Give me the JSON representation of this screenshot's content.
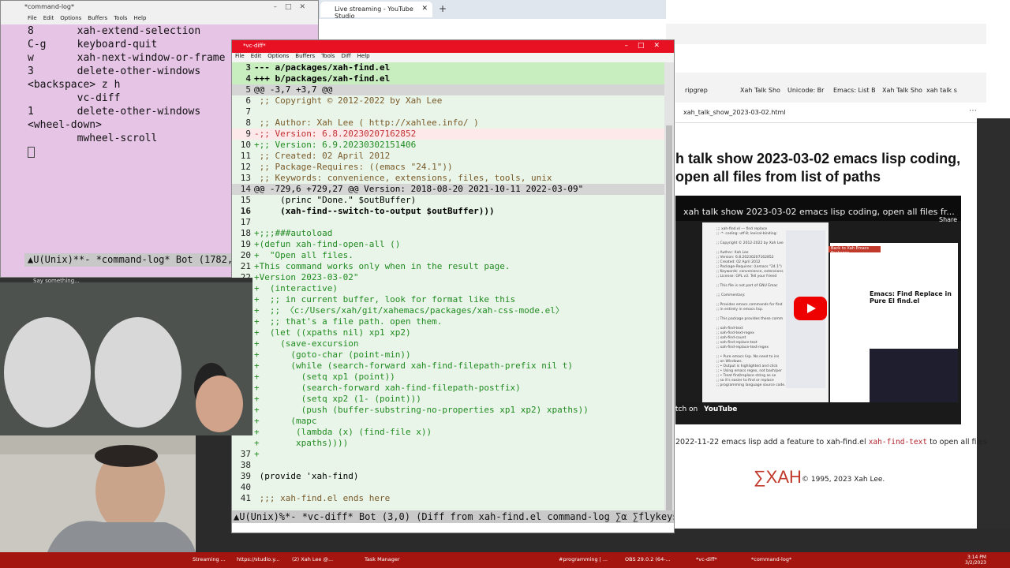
{
  "cmdlog": {
    "title": "*command-log*",
    "menu": [
      "File",
      "Edit",
      "Options",
      "Buffers",
      "Tools",
      "Help"
    ],
    "lines": [
      "8       xah-extend-selection",
      "C-g     keyboard-quit",
      "w       xah-next-window-or-frame",
      "3       delete-other-windows",
      "<backspace> z h",
      "        vc-diff",
      "1       delete-other-windows",
      "<wheel-down>",
      "        mwheel-scroll"
    ],
    "modeline": "U(Unix)**- *command-log* Bot (1782,0)"
  },
  "ytstudio": {
    "tab_label": "Live streaming - YouTube Studio"
  },
  "browser": {
    "tabs": [
      "ripgrep",
      "Xah Talk Sho",
      "Unicode: Br",
      "Emacs: List B",
      "Xah Talk Sho",
      "xah talk s"
    ],
    "url": "xah_talk_show_2023-03-02.html",
    "heading": "h talk show 2023-03-02 emacs lisp coding, open all files from list of paths",
    "video_title": "xah talk show 2023-03-02 emacs lisp coding, open all files fr...",
    "video_share": "Share",
    "video_watch": "tch on",
    "video_logo": "YouTube",
    "video_red_button": "Back to Xah Emacs Packages",
    "video_page_title": "Emacs: Find Replace in Pure El find.el",
    "note_prefix": "2022-11-22 emacs lisp add a feature to xah-find.el ",
    "note_code": "xah-find-text",
    "note_suffix": " to open all files",
    "logo": "∑XAH",
    "copyright": "© 1995, 2023 Xah Lee."
  },
  "vcdiff": {
    "title": "*vc-diff*",
    "menu": [
      "File",
      "Edit",
      "Options",
      "Buffers",
      "Tools",
      "Diff",
      "Help"
    ],
    "lines": [
      {
        "n": "3",
        "t": "--- a/packages/xah-find.el",
        "cls": "hl-green b"
      },
      {
        "n": "4",
        "t": "+++ b/packages/xah-find.el",
        "cls": "hl-green b"
      },
      {
        "n": "5",
        "t": "@@ -3,7 +3,7 @@",
        "cls": "hunk"
      },
      {
        "n": "6",
        "t": " ;; Copyright © 2012-2022 by Xah Lee",
        "cls": "c-gray"
      },
      {
        "n": "7",
        "t": "",
        "cls": ""
      },
      {
        "n": "8",
        "t": " ;; Author: Xah Lee ( http://xahlee.info/ )",
        "cls": "c-gray"
      },
      {
        "n": "9",
        "t": "-;; Version: 6.8.20230207162852",
        "cls": "hl-red c-red"
      },
      {
        "n": "10",
        "t": "+;; Version: 6.9.20230302151406",
        "cls": "c-green"
      },
      {
        "n": "11",
        "t": " ;; Created: 02 April 2012",
        "cls": "c-gray"
      },
      {
        "n": "12",
        "t": " ;; Package-Requires: ((emacs \"24.1\"))",
        "cls": "c-gray"
      },
      {
        "n": "13",
        "t": " ;; Keywords: convenience, extensions, files, tools, unix",
        "cls": "c-gray"
      },
      {
        "n": "14",
        "t": "@@ -729,6 +729,27 @@ Version: 2018-08-20 2021-10-11 2022-03-09\"",
        "cls": "hunk"
      },
      {
        "n": "15",
        "t": "     (princ \"Done.\" $outBuffer)",
        "cls": ""
      },
      {
        "n": "16",
        "t": "     (xah-find--switch-to-output $outBuffer)))",
        "cls": "b"
      },
      {
        "n": "17",
        "t": "",
        "cls": ""
      },
      {
        "n": "18",
        "t": "+;;;###autoload",
        "cls": "c-green"
      },
      {
        "n": "19",
        "t": "+(defun xah-find-open-all ()",
        "cls": "c-green"
      },
      {
        "n": "20",
        "t": "+  \"Open all files.",
        "cls": "c-green"
      },
      {
        "n": "21",
        "t": "+This command works only when in the result page.",
        "cls": "c-green"
      },
      {
        "n": "22",
        "t": "+Version 2023-03-02\"",
        "cls": "c-green"
      },
      {
        "n": "",
        "t": "+  (interactive)",
        "cls": "c-green"
      },
      {
        "n": "",
        "t": "+  ;; in current buffer, look for format like this",
        "cls": "c-green"
      },
      {
        "n": "",
        "t": "+  ;; 〈c:/Users/xah/git/xahemacs/packages/xah-css-mode.el〉",
        "cls": "c-green"
      },
      {
        "n": "",
        "t": "+  ;; that's a file path. open them.",
        "cls": "c-green"
      },
      {
        "n": "",
        "t": "+  (let ((xpaths nil) xp1 xp2)",
        "cls": "c-green"
      },
      {
        "n": "",
        "t": "+    (save-excursion",
        "cls": "c-green"
      },
      {
        "n": "",
        "t": "+      (goto-char (point-min))",
        "cls": "c-green"
      },
      {
        "n": "",
        "t": "+      (while (search-forward xah-find-filepath-prefix nil t)",
        "cls": "c-green"
      },
      {
        "n": "",
        "t": "+        (setq xp1 (point))",
        "cls": "c-green"
      },
      {
        "n": "",
        "t": "+        (search-forward xah-find-filepath-postfix)",
        "cls": "c-green"
      },
      {
        "n": "",
        "t": "+        (setq xp2 (1- (point)))",
        "cls": "c-green"
      },
      {
        "n": "",
        "t": "+        (push (buffer-substring-no-properties xp1 xp2) xpaths))",
        "cls": "c-green"
      },
      {
        "n": "",
        "t": "+      (mapc",
        "cls": "c-green"
      },
      {
        "n": "",
        "t": "+       (lambda (x) (find-file x))",
        "cls": "c-green"
      },
      {
        "n": "",
        "t": "+       xpaths))))",
        "cls": "c-green"
      },
      {
        "n": "37",
        "t": "+",
        "cls": "c-green"
      },
      {
        "n": "38",
        "t": "",
        "cls": ""
      },
      {
        "n": "39",
        "t": " (provide 'xah-find)",
        "cls": ""
      },
      {
        "n": "40",
        "t": "",
        "cls": ""
      },
      {
        "n": "41",
        "t": " ;;; xah-find.el ends here",
        "cls": "c-gray"
      }
    ],
    "modeline": "U(Unix)%*- *vc-diff* Bot (3,0) (Diff from xah-find.el command-log ∑α ∑flykeys Abbrev"
  },
  "cam": {
    "say_something": "Say something..."
  },
  "taskbar": {
    "items": [
      "Streaming ...",
      "https://studio.y...",
      "(2) Xah Lee @...",
      "Task Manager",
      "#programming | ...",
      "OBS 29.0.2 (64-...",
      "*vc-diff*",
      "*command-log*"
    ],
    "time": "3:14 PM",
    "date": "3/2/2023"
  },
  "colors": {
    "taskbar": "#a5150f",
    "emacs_title_active": "#e81123",
    "diff_bg": "#e8f5e8",
    "cmdlog_bg": "#e6c4e6"
  }
}
